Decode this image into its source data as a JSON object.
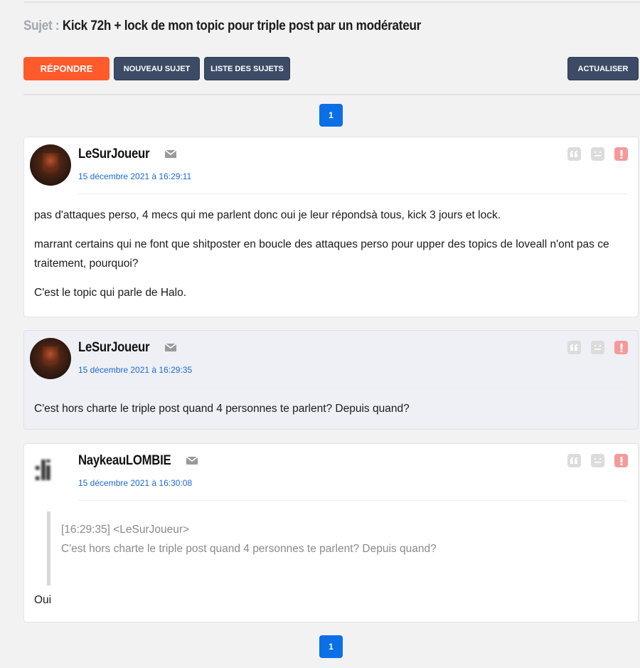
{
  "subject": {
    "label": "Sujet :",
    "title": "Kick 72h + lock de mon topic pour triple post par un modérateur"
  },
  "toolbar": {
    "reply_label": "Répondre",
    "new_topic_label": "Nouveau sujet",
    "topic_list_label": "Liste des sujets",
    "refresh_label": "Actualiser"
  },
  "pagination": {
    "top_page": "1",
    "bottom_page": "1"
  },
  "colors": {
    "accent": "#ff5a2b",
    "dark_button": "#3d4b66",
    "link": "#1a6ad3",
    "page": "#0b6fe8"
  },
  "posts": [
    {
      "author": "LeSurJoueur",
      "date": "15 décembre 2021 à 16:29:11",
      "paragraphs": [
        "pas d'attaques perso, 4 mecs qui me parlent donc oui je leur répondsà tous, kick 3 jours et lock.",
        "marrant certains qui ne font que shitposter en boucle des attaques perso pour upper des topics de loveall n'ont pas ce traitement, pourquoi?",
        "C'est le topic qui parle de Halo."
      ]
    },
    {
      "author": "LeSurJoueur",
      "date": "15 décembre 2021 à 16:29:35",
      "paragraphs": [
        "C'est hors charte le triple post quand 4 personnes te parlent? Depuis quand?"
      ]
    },
    {
      "author": "NaykeauLOMBIE",
      "date": "15 décembre 2021 à 16:30:08",
      "quote_header": "[16:29:35] <LeSurJoueur>",
      "quote_text": "C'est hors charte le triple post quand 4 personnes te parlent? Depuis quand?",
      "paragraphs": [
        "Oui"
      ]
    }
  ],
  "icons": [
    "mail-icon",
    "quote-icon",
    "face-icon",
    "report-icon"
  ]
}
